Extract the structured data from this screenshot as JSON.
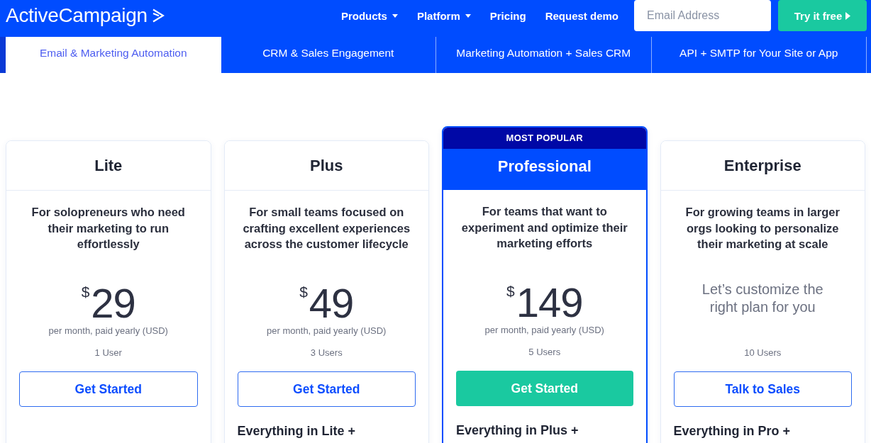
{
  "header": {
    "logo": "ActiveCampaign",
    "nav": [
      {
        "label": "Products",
        "dropdown": true
      },
      {
        "label": "Platform",
        "dropdown": true
      },
      {
        "label": "Pricing",
        "dropdown": false
      },
      {
        "label": "Request demo",
        "dropdown": false
      }
    ],
    "email_field": {
      "placeholder": "Email Address"
    },
    "cta_button": "Try it free"
  },
  "tabs": [
    {
      "label": "Email & Marketing Automation",
      "selected": true
    },
    {
      "label": "CRM & Sales Engagement",
      "selected": false
    },
    {
      "label": "Marketing Automation + Sales CRM",
      "selected": false
    },
    {
      "label": "API + SMTP for Your Site or App",
      "selected": false
    }
  ],
  "plans": [
    {
      "name": "Lite",
      "featured": false,
      "description": "For solopreneurs who need their marketing to run effortlessly",
      "pricing": {
        "kind": "price",
        "currency": "$",
        "amount": "29",
        "billing": "per month, paid yearly (USD)"
      },
      "users": "1 User",
      "button": {
        "label": "Get Started",
        "kind": "outline"
      }
    },
    {
      "name": "Plus",
      "featured": false,
      "description": "For small teams focused on crafting excellent experiences across the customer lifecycle",
      "pricing": {
        "kind": "price",
        "currency": "$",
        "amount": "49",
        "billing": "per month, paid yearly (USD)"
      },
      "users": "3 Users",
      "button": {
        "label": "Get Started",
        "kind": "outline"
      },
      "includes": "Everything in Lite +"
    },
    {
      "name": "Professional",
      "featured": true,
      "badge": "MOST POPULAR",
      "description": "For teams that want to experiment and optimize their marketing efforts",
      "pricing": {
        "kind": "price",
        "currency": "$",
        "amount": "149",
        "billing": "per month, paid yearly (USD)"
      },
      "users": "5 Users",
      "button": {
        "label": "Get Started",
        "kind": "filled"
      },
      "includes": "Everything in Plus +"
    },
    {
      "name": "Enterprise",
      "featured": false,
      "description": "For growing teams in larger orgs looking to personalize their marketing at scale",
      "pricing": {
        "kind": "quote",
        "text": "Let’s customize the right plan for you"
      },
      "users": "10 Users",
      "button": {
        "label": "Talk to Sales",
        "kind": "outline"
      },
      "includes": "Everything in Pro +"
    }
  ]
}
